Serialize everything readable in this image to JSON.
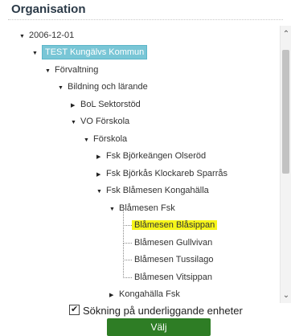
{
  "panel": {
    "title": "Organisation"
  },
  "tree": {
    "n1": "2006-12-01",
    "n2": "TEST Kungälvs Kommun",
    "n3": "Förvaltning",
    "n4": "Bildning och lärande",
    "n5": "BoL Sektorstöd",
    "n6": "VO Förskola",
    "n7": "Förskola",
    "n8": "Fsk Björkeängen Olseröd",
    "n9": "Fsk Björkås Klockareb Sparrås",
    "n10": "Fsk Blåmesen Kongahälla",
    "n11": "Blåmesen Fsk",
    "n12": "Blåmesen Blåsippan",
    "n13": "Blåmesen Gullvivan",
    "n14": "Blåmesen Tussilago",
    "n15": "Blåmesen Vitsippan",
    "n16": "Kongahälla Fsk"
  },
  "toggles": {
    "expanded": "▼",
    "collapsed": "▶"
  },
  "search": {
    "label": "Sökning på underliggande enheter",
    "checked": true,
    "check": "✔"
  },
  "actions": {
    "select": "Välj"
  },
  "scroll": {
    "up": "⌃",
    "down": "⌄"
  },
  "colors": {
    "selected": "#79c6d6",
    "highlight": "#f6f51a",
    "button": "#2e7d25"
  }
}
